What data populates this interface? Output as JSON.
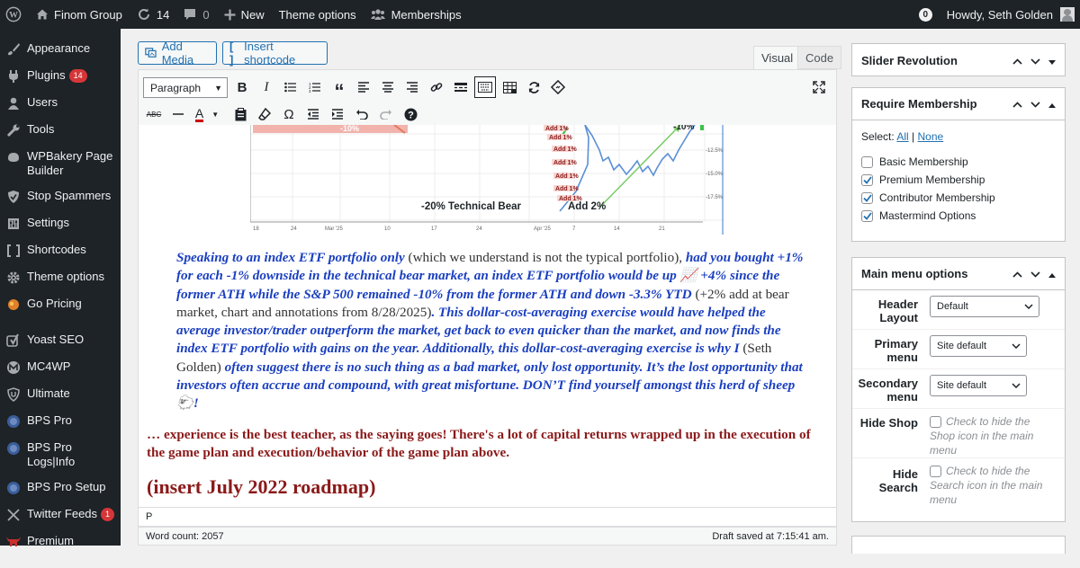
{
  "adminbar": {
    "site_name": "Finom Group",
    "updates_count": "14",
    "comments_count": "0",
    "new_label": "New",
    "theme_options_label": "Theme options",
    "memberships_label": "Memberships",
    "notification_count": "0",
    "greeting": "Howdy, Seth Golden"
  },
  "sidebar": {
    "items": [
      {
        "label": "Appearance",
        "icon": "paintbrush-icon"
      },
      {
        "label": "Plugins",
        "icon": "plug-icon",
        "badge": "14"
      },
      {
        "label": "Users",
        "icon": "users-icon"
      },
      {
        "label": "Tools",
        "icon": "wrench-icon"
      },
      {
        "label": "WPBakery Page Builder",
        "icon": "wpbakery-icon"
      },
      {
        "label": "Stop Spammers",
        "icon": "shield-icon"
      },
      {
        "label": "Settings",
        "icon": "settings-icon"
      },
      {
        "label": "Shortcodes",
        "icon": "brackets-icon"
      },
      {
        "label": "Theme options",
        "icon": "gear-icon"
      },
      {
        "label": "Go Pricing",
        "icon": "go-pricing-icon"
      },
      {
        "label": "Yoast SEO",
        "icon": "yoast-icon"
      },
      {
        "label": "MC4WP",
        "icon": "mc4wp-icon"
      },
      {
        "label": "Ultimate",
        "icon": "ultimate-icon"
      },
      {
        "label": "BPS Pro",
        "icon": "bps-icon"
      },
      {
        "label": "BPS Pro Logs|Info",
        "icon": "bps-icon"
      },
      {
        "label": "BPS Pro Setup",
        "icon": "bps-icon"
      },
      {
        "label": "Twitter Feeds",
        "icon": "x-icon",
        "badge": "1"
      },
      {
        "label": "Premium Financial Widgets",
        "icon": "bull-icon"
      }
    ]
  },
  "editor": {
    "add_media": "Add Media",
    "insert_shortcode": "Insert shortcode",
    "tab_visual": "Visual",
    "tab_code": "Code",
    "format_select": "Paragraph",
    "path": "P",
    "word_count": "Word count: 2057",
    "draft_saved": "Draft saved at 7:15:41 am."
  },
  "content": {
    "chart_labels": {
      "bear": "-20% Technical Bear",
      "add2": "Add 2%",
      "add1": "Add 1%",
      "top_left": "-10%",
      "top_right": "-10%",
      "y1": "-12.5%",
      "y2": "-15.0%",
      "y3": "-17.5%",
      "x_ticks": [
        "18",
        "24",
        "Mar '25",
        "10",
        "17",
        "24",
        "Apr '25",
        "7",
        "14",
        "21"
      ]
    },
    "p1_a": "Speaking to an index ETF portfolio only",
    "p1_b": " (which we understand is not the typical portfolio), ",
    "p1_c": "had you bought +1% for each -1% downside in the technical bear market, an index ETF portfolio would be up 📈 +4% since the former ATH while the S&P 500 remained -10% from the former ATH and down -3.3% YTD",
    "p1_d": " (+2% add at bear market, chart and annotations from  8/28/2025)",
    "p1_e": ". This dollar-cost-averaging exercise would have helped the average investor/trader outperform the market, get back to even quicker than the market, and now finds the index ETF portfolio with gains on the year. Additionally, this dollar-cost-averaging exercise is why I ",
    "p1_f": "(Seth Golden)",
    "p1_g": " often suggest there is no such thing as a bad market, only lost opportunity. It’s the lost opportunity that investors often accrue and compound, with great misfortune. DON’T find yourself amongst this herd of sheep 🐑!",
    "p2": "… experience is the best teacher, as the saying goes! There's a lot of capital returns wrapped up in the execution of the game plan and execution/behavior of the game plan above.",
    "heading": "(insert July 2022 roadmap)"
  },
  "panels": {
    "slider_revolution": "Slider Revolution",
    "require_membership": {
      "title": "Require Membership",
      "select_label": "Select:",
      "all": "All",
      "separator": "|",
      "none": "None",
      "options": [
        {
          "label": "Basic Membership",
          "checked": false
        },
        {
          "label": "Premium Membership",
          "checked": true
        },
        {
          "label": "Contributor Membership",
          "checked": true
        },
        {
          "label": "Mastermind Options",
          "checked": true
        }
      ]
    },
    "main_menu": {
      "title": "Main menu options",
      "header_layout_label": "Header Layout",
      "header_layout_value": "Default",
      "primary_menu_label": "Primary menu",
      "primary_menu_value": "Site default",
      "secondary_menu_label": "Secondary menu",
      "secondary_menu_value": "Site default",
      "hide_shop_label": "Hide Shop",
      "hide_shop_text": "Check to hide the Shop icon in the main menu",
      "hide_search_label": "Hide Search",
      "hide_search_text": "Check to hide the Search icon in the main menu"
    }
  }
}
